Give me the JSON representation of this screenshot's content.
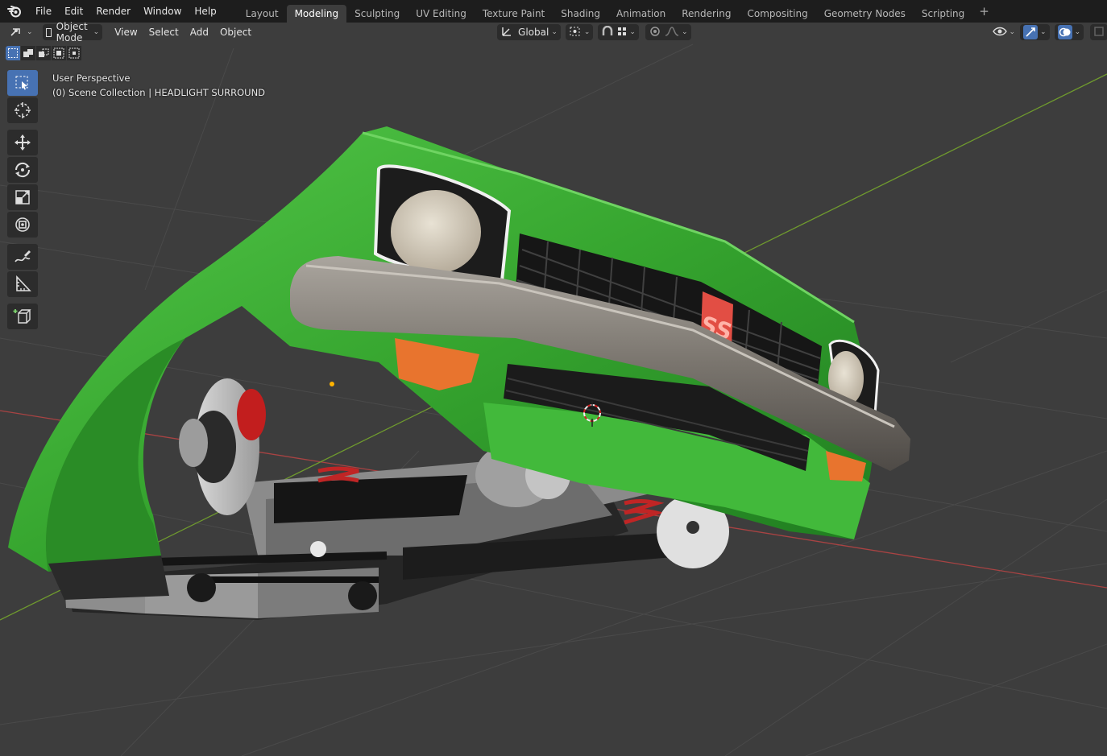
{
  "menu": [
    "File",
    "Edit",
    "Render",
    "Window",
    "Help"
  ],
  "workspaces": [
    "Layout",
    "Modeling",
    "Sculpting",
    "UV Editing",
    "Texture Paint",
    "Shading",
    "Animation",
    "Rendering",
    "Compositing",
    "Geometry Nodes",
    "Scripting"
  ],
  "active_workspace": "Modeling",
  "header": {
    "mode": "Object Mode",
    "view_menu": [
      "View",
      "Select",
      "Add",
      "Object"
    ],
    "transform_orientation": "Global"
  },
  "overlay": {
    "perspective": "User Perspective",
    "collection": "(0) Scene Collection | HEADLIGHT SURROUND"
  },
  "badge_text": "SS",
  "colors": {
    "accent": "#4772b3",
    "car_body": "#3fb33a",
    "bumper": "#8a8580",
    "indicator": "#e8742e",
    "viewport_bg": "#3d3d3d"
  },
  "icons": {
    "logo": "blender-logo-icon",
    "editor_type": "3d-viewport-icon",
    "tools": [
      "select-box-icon",
      "cursor-icon",
      "move-icon",
      "rotate-icon",
      "scale-icon",
      "transform-icon",
      "annotate-icon",
      "measure-icon",
      "add-cube-icon"
    ]
  }
}
